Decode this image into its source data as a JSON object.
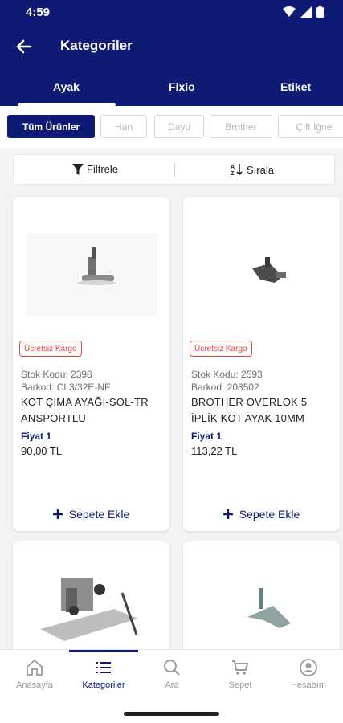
{
  "status": {
    "time": "4:59"
  },
  "header": {
    "title": "Kategoriler"
  },
  "tabs": [
    {
      "label": "Ayak"
    },
    {
      "label": "Fixio"
    },
    {
      "label": "Etiket"
    }
  ],
  "chips": [
    {
      "label": "Tüm Ürünler"
    },
    {
      "label": "Han"
    },
    {
      "label": "Dayu"
    },
    {
      "label": "Brother"
    },
    {
      "label": "Çift İğne"
    }
  ],
  "filterbar": {
    "filter_label": "Filtrele",
    "sort_label": "Sırala"
  },
  "products": [
    {
      "badge": "Ücretsiz Kargo",
      "stock": "Stok Kodu: 2398",
      "barcode": "Barkod: CL3/32E-NF",
      "name": "KOT ÇIMA AYAĞI-SOL-TR ANSPORTLU",
      "price_label": "Fiyat 1",
      "price": "90,00 TL",
      "add_label": "Sepete Ekle"
    },
    {
      "badge": "Ücretsiz Kargo",
      "stock": "Stok Kodu: 2593",
      "barcode": "Barkod: 208502",
      "name": "BROTHER OVERLOK 5 İPLİK KOT AYAK 10MM",
      "price_label": "Fiyat 1",
      "price": "113,22 TL",
      "add_label": "Sepete Ekle"
    }
  ],
  "bottom_nav": [
    {
      "label": "Anasayfa",
      "icon": "home-icon"
    },
    {
      "label": "Kategoriler",
      "icon": "list-icon"
    },
    {
      "label": "Ara",
      "icon": "search-icon"
    },
    {
      "label": "Sepet",
      "icon": "cart-icon"
    },
    {
      "label": "Hesabım",
      "icon": "account-icon"
    }
  ],
  "colors": {
    "primary": "#0f1a74",
    "badge": "#e0493a"
  }
}
